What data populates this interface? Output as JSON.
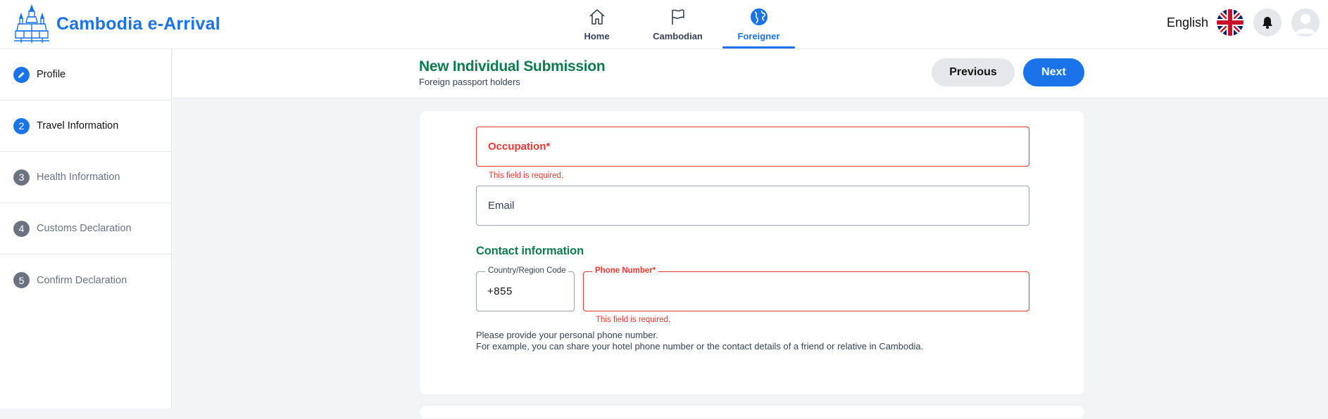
{
  "brand": {
    "title": "Cambodia e-Arrival"
  },
  "nav": [
    {
      "label": "Home",
      "icon": "home-icon"
    },
    {
      "label": "Cambodian",
      "icon": "flag-icon"
    },
    {
      "label": "Foreigner",
      "icon": "globe-icon"
    }
  ],
  "header": {
    "language": "English"
  },
  "steps": [
    {
      "num": "",
      "label": "Profile"
    },
    {
      "num": "2",
      "label": "Travel Information"
    },
    {
      "num": "3",
      "label": "Health Information"
    },
    {
      "num": "4",
      "label": "Customs Declaration"
    },
    {
      "num": "5",
      "label": "Confirm Declaration"
    }
  ],
  "page": {
    "title": "New Individual Submission",
    "subtitle": "Foreign passport holders",
    "previous_label": "Previous",
    "next_label": "Next"
  },
  "form": {
    "occupation_label": "Occupation*",
    "occupation_error": "This field is required.",
    "email_label": "Email",
    "contact_title": "Contact information",
    "country_code_label": "Country/Region Code",
    "country_code_value": "+855",
    "phone_label": "Phone Number*",
    "phone_error": "This field is required.",
    "help_line1": "Please provide your personal phone number.",
    "help_line2": "For example, you can share your hotel phone number or the contact details of a friend or relative in Cambodia."
  },
  "colors": {
    "primary": "#1a73e8",
    "green": "#0f7a4f",
    "error": "#e53935"
  }
}
